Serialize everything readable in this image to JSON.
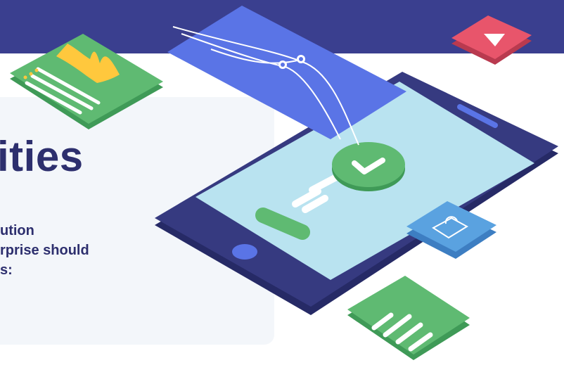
{
  "heading": "ities",
  "body_lines": [
    "ution",
    "rprise should",
    "s:"
  ],
  "colors": {
    "band": "#3a3f8f",
    "card": "#f3f6fa",
    "text": "#2d2f6e",
    "phone_body": "#363a80",
    "phone_screen": "#b9e3f0",
    "blue_card": "#5a74e6",
    "green": "#5fba72",
    "red": "#e8556b",
    "yellow": "#ffc83d",
    "lock_tile": "#5aa2e0"
  },
  "icons": [
    "chart-card-icon",
    "play-icon",
    "checkmark-icon",
    "lock-icon",
    "bars-icon"
  ]
}
